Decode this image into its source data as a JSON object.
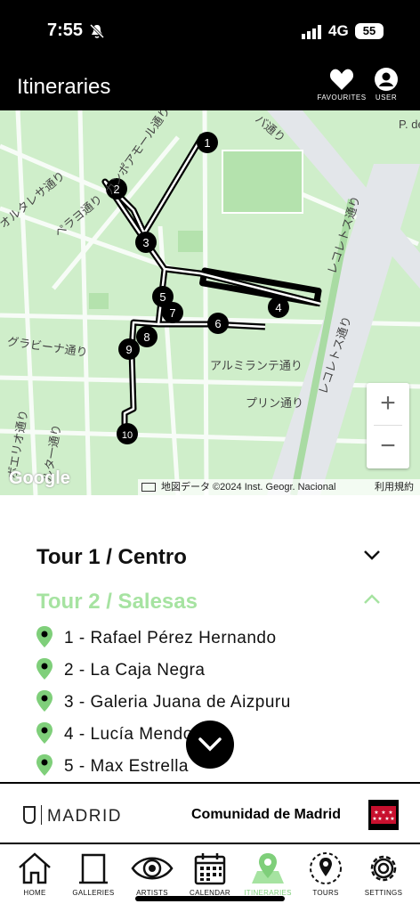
{
  "status": {
    "time": "7:55",
    "network": "4G",
    "battery": "55"
  },
  "header": {
    "title": "Itineraries",
    "favourites_label": "FAVOURITES",
    "user_label": "USER"
  },
  "map": {
    "street_labels": [
      "カンポアモール通り",
      "オルタレサ通り",
      "ペラヨ通り",
      "グラビーナ通り",
      "アルミランテ通り",
      "プリン通り",
      "レコレトス通り",
      "レコレトス通り",
      "バ通り",
      "ボエリオ通り",
      "ルタ一通り",
      "P. de"
    ],
    "markers": [
      "1",
      "2",
      "3",
      "4",
      "5",
      "7",
      "6",
      "8",
      "9",
      "10"
    ],
    "zoom_in": "+",
    "zoom_out": "−",
    "google": "Google",
    "attribution": "地図データ ©2024 Inst. Geogr. Nacional",
    "terms": "利用規約"
  },
  "tours": {
    "tour1": "Tour 1 / Centro",
    "tour2": "Tour 2 / Salesas",
    "stops": [
      "1 - Rafael Pérez Hernando",
      "2 - La Caja Negra",
      "3 - Galeria Juana de Aizpuru",
      "4 - Lucía Mendoza",
      "5 - Max Estrella"
    ]
  },
  "logos": {
    "madrid": "MADRID",
    "comunidad": "Comunidad de Madrid"
  },
  "nav": [
    {
      "label": "HOME",
      "icon": "home-icon"
    },
    {
      "label": "GALLERIES",
      "icon": "gallery-icon"
    },
    {
      "label": "ARTISTS",
      "icon": "eye-icon"
    },
    {
      "label": "CALENDAR",
      "icon": "calendar-icon"
    },
    {
      "label": "ITINERARIES",
      "icon": "map-pin-icon"
    },
    {
      "label": "TOURS",
      "icon": "tour-pin-icon"
    },
    {
      "label": "SETTINGS",
      "icon": "gear-icon"
    }
  ],
  "colors": {
    "accent": "#7fcf7a",
    "tour_active": "#a6e3a1",
    "map_bg": "#cfeeca"
  }
}
